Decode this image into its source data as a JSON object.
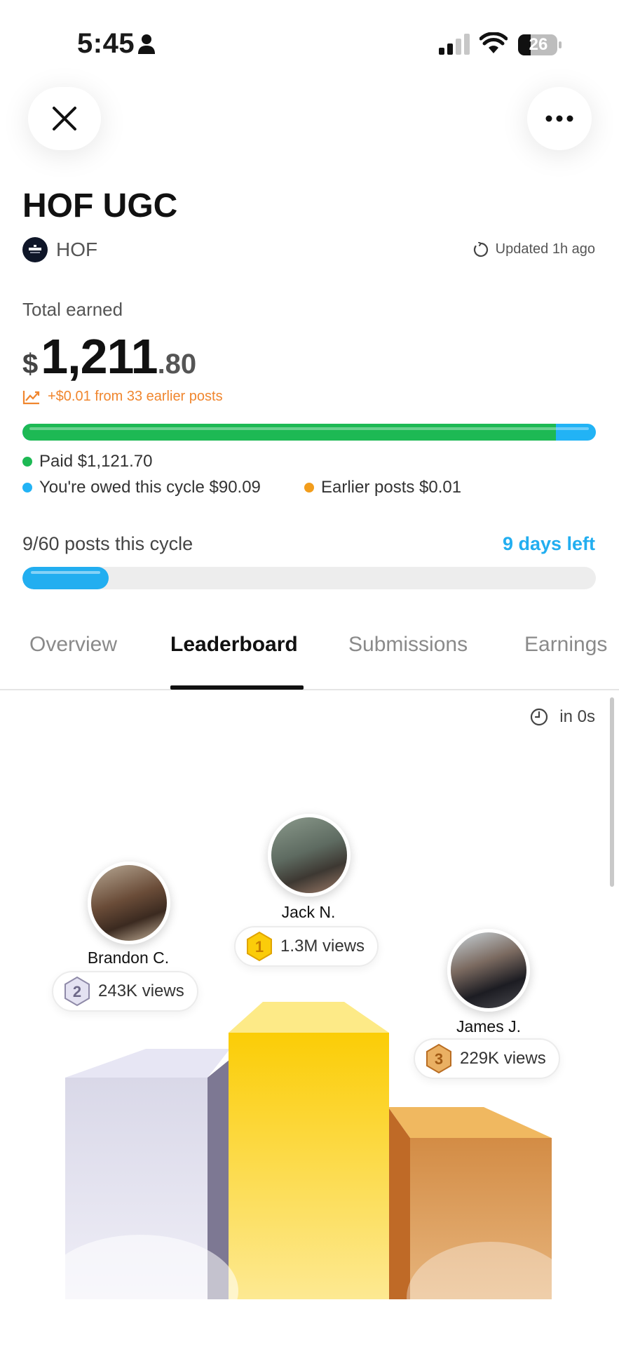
{
  "status_bar": {
    "time": "5:45",
    "battery": "26"
  },
  "campaign": {
    "title": "HOF UGC",
    "brand": "HOF",
    "updated": "Updated 1h ago"
  },
  "earnings": {
    "label": "Total earned",
    "currency": "$",
    "amount_int": "1,211",
    "amount_dec": ".80",
    "trend": "+$0.01 from 33 earlier posts",
    "paid_fraction": 0.93,
    "legend": {
      "paid": "Paid $1,121.70",
      "owed": "You're owed this cycle $90.09",
      "earlier": "Earlier posts $0.01"
    },
    "colors": {
      "paid": "#1db954",
      "owed": "#22b3f5",
      "earlier": "#f29d1c"
    }
  },
  "cycle": {
    "posts": "9/60 posts this cycle",
    "days_left": "9 days left",
    "progress_fraction": 0.15
  },
  "tabs": [
    {
      "label": "Overview"
    },
    {
      "label": "Leaderboard",
      "active": true
    },
    {
      "label": "Submissions"
    },
    {
      "label": "Earnings"
    }
  ],
  "leaderboard": {
    "refresh": "in 0s",
    "podium": [
      {
        "rank": "1",
        "name": "Jack N.",
        "views": "1.3M views"
      },
      {
        "rank": "2",
        "name": "Brandon C.",
        "views": "243K views"
      },
      {
        "rank": "3",
        "name": "James J.",
        "views": "229K views"
      }
    ]
  }
}
